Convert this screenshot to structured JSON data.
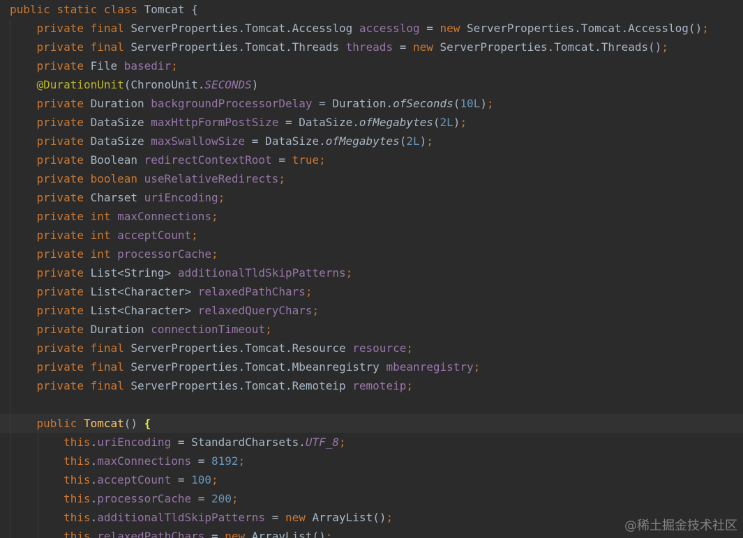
{
  "editor": {
    "watermark": "@稀土掘金技术社区",
    "current_line": 22,
    "lines": [
      {
        "tokens": [
          {
            "t": "public ",
            "c": "kw"
          },
          {
            "t": "static ",
            "c": "kw"
          },
          {
            "t": "class ",
            "c": "kw"
          },
          {
            "t": "Tomcat {",
            "c": "def"
          }
        ]
      },
      {
        "tokens": [
          {
            "t": "    ",
            "c": "def"
          },
          {
            "t": "private ",
            "c": "kw"
          },
          {
            "t": "final ",
            "c": "kw"
          },
          {
            "t": "ServerProperties.Tomcat.Accesslog ",
            "c": "def"
          },
          {
            "t": "accesslog",
            "c": "fld"
          },
          {
            "t": " = ",
            "c": "def"
          },
          {
            "t": "new ",
            "c": "kw"
          },
          {
            "t": "ServerProperties.Tomcat.Accesslog()",
            "c": "def"
          },
          {
            "t": ";",
            "c": "kw"
          }
        ]
      },
      {
        "tokens": [
          {
            "t": "    ",
            "c": "def"
          },
          {
            "t": "private ",
            "c": "kw"
          },
          {
            "t": "final ",
            "c": "kw"
          },
          {
            "t": "ServerProperties.Tomcat.Threads ",
            "c": "def"
          },
          {
            "t": "threads",
            "c": "fld"
          },
          {
            "t": " = ",
            "c": "def"
          },
          {
            "t": "new ",
            "c": "kw"
          },
          {
            "t": "ServerProperties.Tomcat.Threads()",
            "c": "def"
          },
          {
            "t": ";",
            "c": "kw"
          }
        ]
      },
      {
        "tokens": [
          {
            "t": "    ",
            "c": "def"
          },
          {
            "t": "private ",
            "c": "kw"
          },
          {
            "t": "File ",
            "c": "def"
          },
          {
            "t": "basedir",
            "c": "fld"
          },
          {
            "t": ";",
            "c": "kw"
          }
        ]
      },
      {
        "tokens": [
          {
            "t": "    ",
            "c": "def"
          },
          {
            "t": "@DurationUnit",
            "c": "ann"
          },
          {
            "t": "(ChronoUnit.",
            "c": "def"
          },
          {
            "t": "SECONDS",
            "c": "fld it"
          },
          {
            "t": ")",
            "c": "def"
          }
        ]
      },
      {
        "tokens": [
          {
            "t": "    ",
            "c": "def"
          },
          {
            "t": "private ",
            "c": "kw"
          },
          {
            "t": "Duration ",
            "c": "def"
          },
          {
            "t": "backgroundProcessorDelay",
            "c": "fld"
          },
          {
            "t": " = Duration.",
            "c": "def"
          },
          {
            "t": "ofSeconds",
            "c": "def it"
          },
          {
            "t": "(",
            "c": "def"
          },
          {
            "t": "10L",
            "c": "num"
          },
          {
            "t": ")",
            "c": "def"
          },
          {
            "t": ";",
            "c": "kw"
          }
        ]
      },
      {
        "tokens": [
          {
            "t": "    ",
            "c": "def"
          },
          {
            "t": "private ",
            "c": "kw"
          },
          {
            "t": "DataSize ",
            "c": "def"
          },
          {
            "t": "maxHttpFormPostSize",
            "c": "fld"
          },
          {
            "t": " = DataSize.",
            "c": "def"
          },
          {
            "t": "ofMegabytes",
            "c": "def it"
          },
          {
            "t": "(",
            "c": "def"
          },
          {
            "t": "2L",
            "c": "num"
          },
          {
            "t": ")",
            "c": "def"
          },
          {
            "t": ";",
            "c": "kw"
          }
        ]
      },
      {
        "tokens": [
          {
            "t": "    ",
            "c": "def"
          },
          {
            "t": "private ",
            "c": "kw"
          },
          {
            "t": "DataSize ",
            "c": "def"
          },
          {
            "t": "maxSwallowSize",
            "c": "fld"
          },
          {
            "t": " = DataSize.",
            "c": "def"
          },
          {
            "t": "ofMegabytes",
            "c": "def it"
          },
          {
            "t": "(",
            "c": "def"
          },
          {
            "t": "2L",
            "c": "num"
          },
          {
            "t": ")",
            "c": "def"
          },
          {
            "t": ";",
            "c": "kw"
          }
        ]
      },
      {
        "tokens": [
          {
            "t": "    ",
            "c": "def"
          },
          {
            "t": "private ",
            "c": "kw"
          },
          {
            "t": "Boolean ",
            "c": "def"
          },
          {
            "t": "redirectContextRoot",
            "c": "fld"
          },
          {
            "t": " = ",
            "c": "def"
          },
          {
            "t": "true",
            "c": "kw"
          },
          {
            "t": ";",
            "c": "kw"
          }
        ]
      },
      {
        "tokens": [
          {
            "t": "    ",
            "c": "def"
          },
          {
            "t": "private ",
            "c": "kw"
          },
          {
            "t": "boolean ",
            "c": "kw"
          },
          {
            "t": "useRelativeRedirects",
            "c": "fld"
          },
          {
            "t": ";",
            "c": "kw"
          }
        ]
      },
      {
        "tokens": [
          {
            "t": "    ",
            "c": "def"
          },
          {
            "t": "private ",
            "c": "kw"
          },
          {
            "t": "Charset ",
            "c": "def"
          },
          {
            "t": "uriEncoding",
            "c": "fld"
          },
          {
            "t": ";",
            "c": "kw"
          }
        ]
      },
      {
        "tokens": [
          {
            "t": "    ",
            "c": "def"
          },
          {
            "t": "private ",
            "c": "kw"
          },
          {
            "t": "int ",
            "c": "kw"
          },
          {
            "t": "maxConnections",
            "c": "fld"
          },
          {
            "t": ";",
            "c": "kw"
          }
        ]
      },
      {
        "tokens": [
          {
            "t": "    ",
            "c": "def"
          },
          {
            "t": "private ",
            "c": "kw"
          },
          {
            "t": "int ",
            "c": "kw"
          },
          {
            "t": "acceptCount",
            "c": "fld"
          },
          {
            "t": ";",
            "c": "kw"
          }
        ]
      },
      {
        "tokens": [
          {
            "t": "    ",
            "c": "def"
          },
          {
            "t": "private ",
            "c": "kw"
          },
          {
            "t": "int ",
            "c": "kw"
          },
          {
            "t": "processorCache",
            "c": "fld"
          },
          {
            "t": ";",
            "c": "kw"
          }
        ]
      },
      {
        "tokens": [
          {
            "t": "    ",
            "c": "def"
          },
          {
            "t": "private ",
            "c": "kw"
          },
          {
            "t": "List<String> ",
            "c": "def"
          },
          {
            "t": "additionalTldSkipPatterns",
            "c": "fld"
          },
          {
            "t": ";",
            "c": "kw"
          }
        ]
      },
      {
        "tokens": [
          {
            "t": "    ",
            "c": "def"
          },
          {
            "t": "private ",
            "c": "kw"
          },
          {
            "t": "List<Character> ",
            "c": "def"
          },
          {
            "t": "relaxedPathChars",
            "c": "fld"
          },
          {
            "t": ";",
            "c": "kw"
          }
        ]
      },
      {
        "tokens": [
          {
            "t": "    ",
            "c": "def"
          },
          {
            "t": "private ",
            "c": "kw"
          },
          {
            "t": "List<Character> ",
            "c": "def"
          },
          {
            "t": "relaxedQueryChars",
            "c": "fld"
          },
          {
            "t": ";",
            "c": "kw"
          }
        ]
      },
      {
        "tokens": [
          {
            "t": "    ",
            "c": "def"
          },
          {
            "t": "private ",
            "c": "kw"
          },
          {
            "t": "Duration ",
            "c": "def"
          },
          {
            "t": "connectionTimeout",
            "c": "fld"
          },
          {
            "t": ";",
            "c": "kw"
          }
        ]
      },
      {
        "tokens": [
          {
            "t": "    ",
            "c": "def"
          },
          {
            "t": "private ",
            "c": "kw"
          },
          {
            "t": "final ",
            "c": "kw"
          },
          {
            "t": "ServerProperties.Tomcat.Resource ",
            "c": "def"
          },
          {
            "t": "resource",
            "c": "fld"
          },
          {
            "t": ";",
            "c": "kw"
          }
        ]
      },
      {
        "tokens": [
          {
            "t": "    ",
            "c": "def"
          },
          {
            "t": "private ",
            "c": "kw"
          },
          {
            "t": "final ",
            "c": "kw"
          },
          {
            "t": "ServerProperties.Tomcat.Mbeanregistry ",
            "c": "def"
          },
          {
            "t": "mbeanregistry",
            "c": "fld"
          },
          {
            "t": ";",
            "c": "kw"
          }
        ]
      },
      {
        "tokens": [
          {
            "t": "    ",
            "c": "def"
          },
          {
            "t": "private ",
            "c": "kw"
          },
          {
            "t": "final ",
            "c": "kw"
          },
          {
            "t": "ServerProperties.Tomcat.Remoteip ",
            "c": "def"
          },
          {
            "t": "remoteip",
            "c": "fld"
          },
          {
            "t": ";",
            "c": "kw"
          }
        ]
      },
      {
        "tokens": []
      },
      {
        "tokens": [
          {
            "t": "    ",
            "c": "def"
          },
          {
            "t": "public ",
            "c": "kw"
          },
          {
            "t": "Tomcat",
            "c": "fn"
          },
          {
            "t": "() ",
            "c": "def"
          },
          {
            "t": "{",
            "c": "brace"
          }
        ]
      },
      {
        "tokens": [
          {
            "t": "        ",
            "c": "def"
          },
          {
            "t": "this",
            "c": "kw"
          },
          {
            "t": ".",
            "c": "def"
          },
          {
            "t": "uriEncoding",
            "c": "fld"
          },
          {
            "t": " = StandardCharsets.",
            "c": "def"
          },
          {
            "t": "UTF_8",
            "c": "fld it"
          },
          {
            "t": ";",
            "c": "kw"
          }
        ]
      },
      {
        "tokens": [
          {
            "t": "        ",
            "c": "def"
          },
          {
            "t": "this",
            "c": "kw"
          },
          {
            "t": ".",
            "c": "def"
          },
          {
            "t": "maxConnections",
            "c": "fld"
          },
          {
            "t": " = ",
            "c": "def"
          },
          {
            "t": "8192",
            "c": "num"
          },
          {
            "t": ";",
            "c": "kw"
          }
        ]
      },
      {
        "tokens": [
          {
            "t": "        ",
            "c": "def"
          },
          {
            "t": "this",
            "c": "kw"
          },
          {
            "t": ".",
            "c": "def"
          },
          {
            "t": "acceptCount",
            "c": "fld"
          },
          {
            "t": " = ",
            "c": "def"
          },
          {
            "t": "100",
            "c": "num"
          },
          {
            "t": ";",
            "c": "kw"
          }
        ]
      },
      {
        "tokens": [
          {
            "t": "        ",
            "c": "def"
          },
          {
            "t": "this",
            "c": "kw"
          },
          {
            "t": ".",
            "c": "def"
          },
          {
            "t": "processorCache",
            "c": "fld"
          },
          {
            "t": " = ",
            "c": "def"
          },
          {
            "t": "200",
            "c": "num"
          },
          {
            "t": ";",
            "c": "kw"
          }
        ]
      },
      {
        "tokens": [
          {
            "t": "        ",
            "c": "def"
          },
          {
            "t": "this",
            "c": "kw"
          },
          {
            "t": ".",
            "c": "def"
          },
          {
            "t": "additionalTldSkipPatterns",
            "c": "fld"
          },
          {
            "t": " = ",
            "c": "def"
          },
          {
            "t": "new ",
            "c": "kw"
          },
          {
            "t": "ArrayList()",
            "c": "def"
          },
          {
            "t": ";",
            "c": "kw"
          }
        ]
      },
      {
        "tokens": [
          {
            "t": "        ",
            "c": "def"
          },
          {
            "t": "this",
            "c": "kw"
          },
          {
            "t": ".",
            "c": "def"
          },
          {
            "t": "relaxedPathChars",
            "c": "fld"
          },
          {
            "t": " = ",
            "c": "def"
          },
          {
            "t": "new ",
            "c": "kw"
          },
          {
            "t": "ArrayList()",
            "c": "def"
          },
          {
            "t": ";",
            "c": "kw"
          }
        ]
      }
    ]
  },
  "colors": {
    "background": "#2b2b2b",
    "keyword": "#cc7832",
    "field": "#9876aa",
    "number": "#6897bb",
    "annotation": "#bbb529",
    "method_declaration": "#ffc66d",
    "default_text": "#a9b7c6",
    "current_line": "#323232"
  }
}
